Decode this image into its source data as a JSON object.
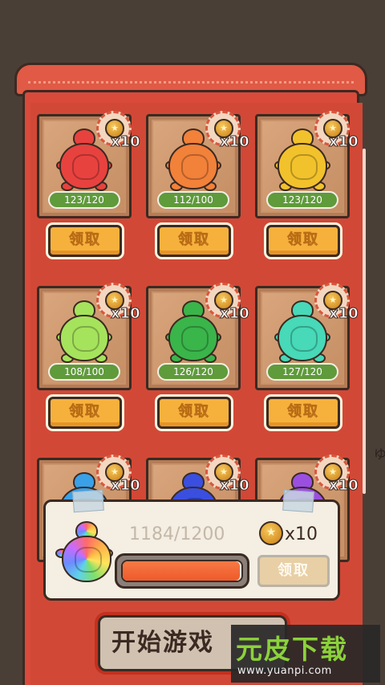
{
  "slots": [
    {
      "multiplier": "x10",
      "count": "123/120",
      "claim": "领取",
      "color": "#e8423f"
    },
    {
      "multiplier": "x10",
      "count": "112/100",
      "claim": "领取",
      "color": "#f2813a"
    },
    {
      "multiplier": "x10",
      "count": "123/120",
      "claim": "领取",
      "color": "#f2c22c"
    },
    {
      "multiplier": "x10",
      "count": "108/100",
      "claim": "领取",
      "color": "#a6e35c"
    },
    {
      "multiplier": "x10",
      "count": "126/120",
      "claim": "领取",
      "color": "#3ab54a"
    },
    {
      "multiplier": "x10",
      "count": "127/120",
      "claim": "领取",
      "color": "#47d9b8"
    },
    {
      "multiplier": "x10",
      "color": "#3aa0e8"
    },
    {
      "multiplier": "x10",
      "color": "#3a4fe0"
    },
    {
      "multiplier": "x10",
      "color": "#9b4fe0"
    }
  ],
  "panel": {
    "progress_text": "1184/1200",
    "progress_fraction": 0.987,
    "reward_multiplier": "x10",
    "claim": "领取"
  },
  "start_button": "开始游戏",
  "watermark": {
    "main_a": "元皮",
    "main_b": "下载",
    "url": "www.yuanpi.com"
  },
  "colors": {
    "machine_red": "#d94a3b",
    "outline": "#3b2a22",
    "claim_orange": "#f6b13d",
    "count_green": "#5f9a3b",
    "background": "#4a3f37"
  },
  "icons": [
    "coin-icon",
    "turtle-icon",
    "rainbow-turtle-icon",
    "tape-icon"
  ]
}
